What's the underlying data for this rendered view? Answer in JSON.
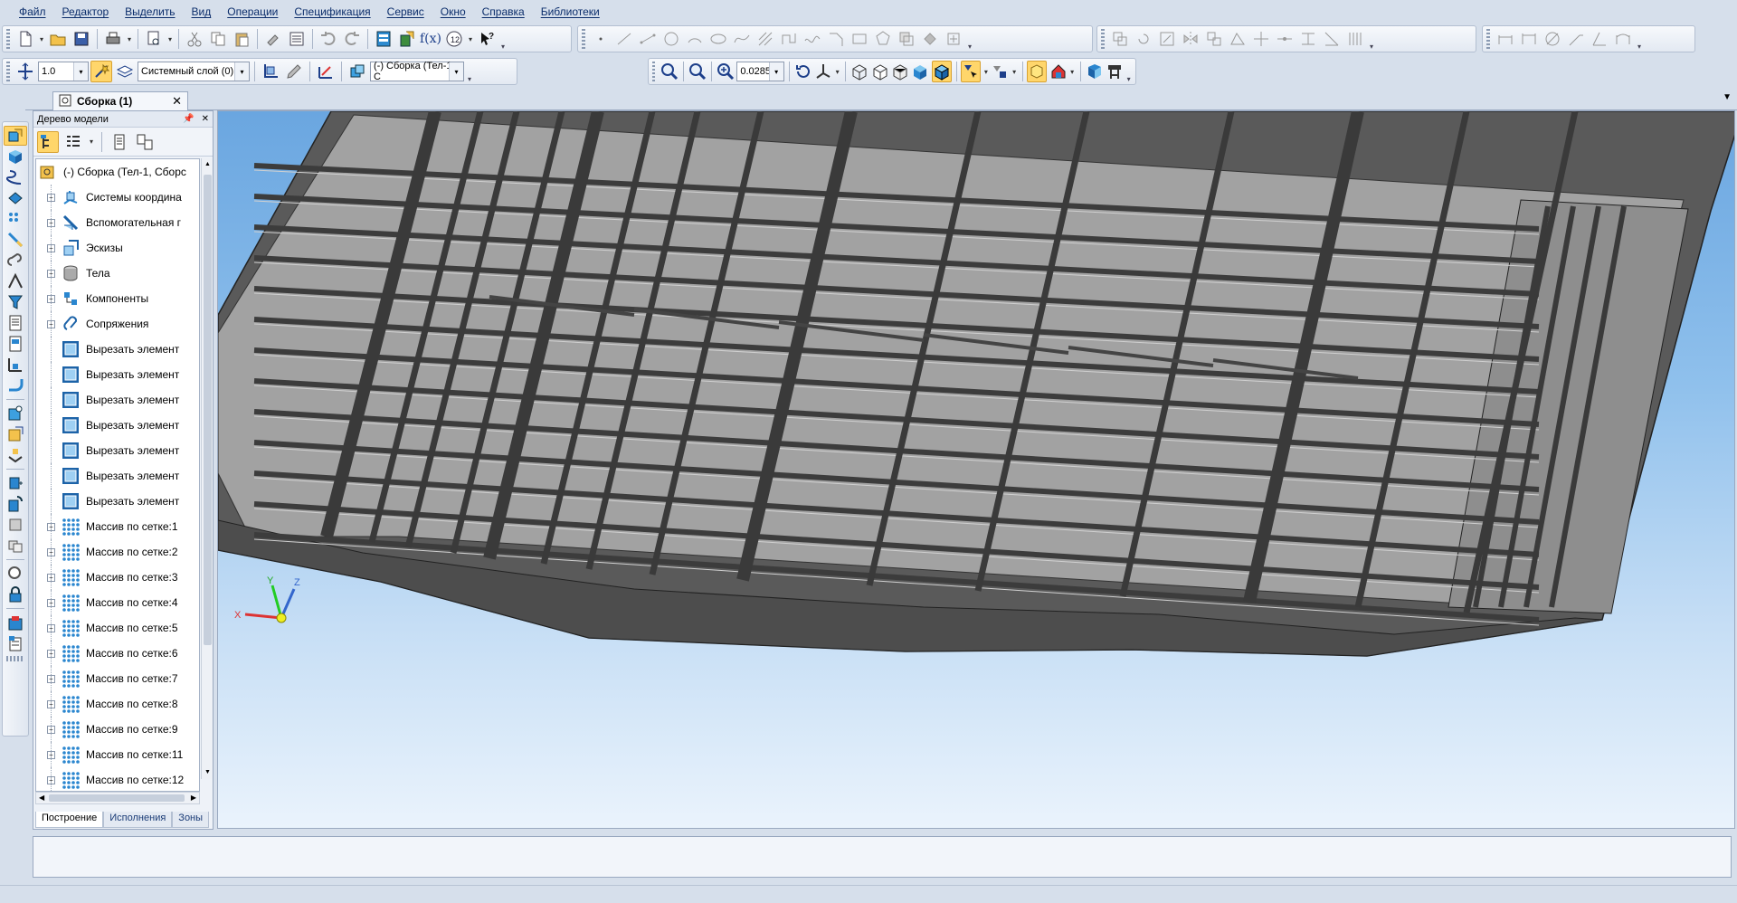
{
  "menu": [
    "Файл",
    "Редактор",
    "Выделить",
    "Вид",
    "Операции",
    "Спецификация",
    "Сервис",
    "Окно",
    "Справка",
    "Библиотеки"
  ],
  "toolbar": {
    "step_value": "1.0",
    "layer_value": "Системный слой (0)",
    "assembly_value": "(-) Сборка (Тел-1, С",
    "zoom_value": "0.0285",
    "fx_label": "f(x)"
  },
  "document_tab": {
    "label": "Сборка (1)",
    "close": "✕"
  },
  "tree": {
    "title": "Дерево модели",
    "root": "(-) Сборка (Тел-1, Сборс",
    "items": [
      {
        "label": "Системы координа",
        "icon": "coordinate-systems-icon",
        "expandable": true
      },
      {
        "label": "Вспомогательная г",
        "icon": "auxiliary-geometry-icon",
        "expandable": true
      },
      {
        "label": "Эскизы",
        "icon": "sketches-icon",
        "expandable": true
      },
      {
        "label": "Тела",
        "icon": "bodies-icon",
        "expandable": true
      },
      {
        "label": "Компоненты",
        "icon": "components-icon",
        "expandable": true
      },
      {
        "label": "Сопряжения",
        "icon": "mates-icon",
        "expandable": true
      },
      {
        "label": "Вырезать элемент",
        "icon": "cut-element-icon",
        "expandable": false
      },
      {
        "label": "Вырезать элемент",
        "icon": "cut-element-icon",
        "expandable": false
      },
      {
        "label": "Вырезать элемент",
        "icon": "cut-element-icon",
        "expandable": false
      },
      {
        "label": "Вырезать элемент",
        "icon": "cut-element-icon",
        "expandable": false
      },
      {
        "label": "Вырезать элемент",
        "icon": "cut-element-icon",
        "expandable": false
      },
      {
        "label": "Вырезать элемент",
        "icon": "cut-element-icon",
        "expandable": false
      },
      {
        "label": "Вырезать элемент",
        "icon": "cut-element-icon",
        "expandable": false
      },
      {
        "label": "Массив по сетке:1",
        "icon": "grid-array-icon",
        "expandable": true
      },
      {
        "label": "Массив по сетке:2",
        "icon": "grid-array-icon",
        "expandable": true
      },
      {
        "label": "Массив по сетке:3",
        "icon": "grid-array-icon",
        "expandable": true
      },
      {
        "label": "Массив по сетке:4",
        "icon": "grid-array-icon",
        "expandable": true
      },
      {
        "label": "Массив по сетке:5",
        "icon": "grid-array-icon",
        "expandable": true
      },
      {
        "label": "Массив по сетке:6",
        "icon": "grid-array-icon",
        "expandable": true
      },
      {
        "label": "Массив по сетке:7",
        "icon": "grid-array-icon",
        "expandable": true
      },
      {
        "label": "Массив по сетке:8",
        "icon": "grid-array-icon",
        "expandable": true
      },
      {
        "label": "Массив по сетке:9",
        "icon": "grid-array-icon",
        "expandable": true
      },
      {
        "label": "Массив по сетке:11",
        "icon": "grid-array-icon",
        "expandable": true
      },
      {
        "label": "Массив по сетке:12",
        "icon": "grid-array-icon",
        "expandable": true
      }
    ],
    "tabs": [
      "Построение",
      "Исполнения",
      "Зоны"
    ]
  },
  "axes": {
    "x": "X",
    "y": "Y",
    "z": "Z"
  },
  "colors": {
    "accent": "#ffd66b",
    "viewport_top": "#6aa6e0",
    "viewport_bottom": "#eaf3fc",
    "model_face": "#9c9c9c",
    "model_dark": "#4a4a4a"
  }
}
